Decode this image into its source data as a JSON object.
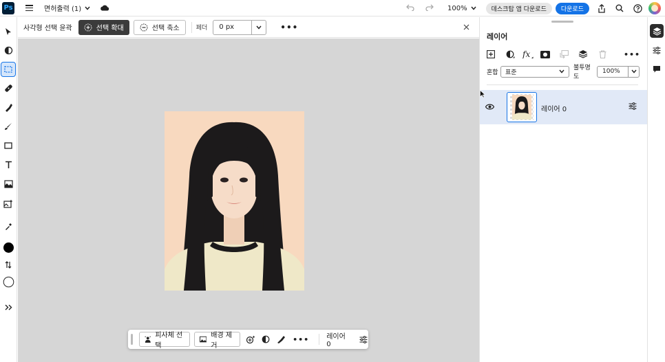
{
  "app": {
    "logo_text": "Ps"
  },
  "topbar": {
    "doc_title": "면허출력 (1)",
    "zoom": "100%",
    "desktop_button": "데스크탑 앱 다운로드",
    "download_button": "다운로드"
  },
  "options": {
    "title": "사각형 선택 윤곽",
    "expand_label": "선택 확대",
    "contract_label": "선택 축소",
    "feather_label": "페더",
    "feather_value": "0 px"
  },
  "taskbar": {
    "select_subject": "피사체 선택",
    "remove_background": "배경 제거",
    "layer_name": "레이어 0"
  },
  "layers_panel": {
    "title": "레이어",
    "blend_label": "혼합",
    "blend_mode": "표준",
    "opacity_label": "불투명도",
    "opacity_value": "100%",
    "layers": [
      {
        "name": "레이어 0",
        "visible": true,
        "selected": true
      }
    ]
  },
  "colors": {
    "accent": "#1473e6",
    "canvas_bg": "#d6d6d6",
    "photo_bg": "#f8d9bf",
    "selected_layer": "#e1e9f7",
    "foreground_swatch": "#000000",
    "background_swatch": "#ffffff"
  },
  "icons": {
    "left_tools": [
      "move-tool-icon",
      "object-selection-icon",
      "marquee-tool-icon",
      "healing-brush-icon",
      "spot-heal-icon",
      "brush-icon",
      "shape-icon",
      "type-icon",
      "crop-icon",
      "generative-fill-icon",
      "eyedropper-icon",
      "foreground-color-icon",
      "swap-colors-icon",
      "background-color-icon",
      "more-tools-icon"
    ],
    "right_rail": [
      "layers-icon",
      "adjustments-icon",
      "comments-icon"
    ]
  }
}
